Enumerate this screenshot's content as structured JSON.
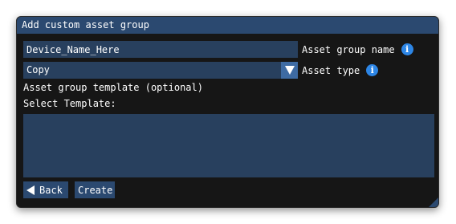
{
  "dialog": {
    "title": "Add custom asset group",
    "name_field": {
      "value": "Device_Name_Here",
      "label": "Asset group name",
      "info_icon": "i"
    },
    "type_field": {
      "selected": "Copy",
      "label": "Asset type",
      "info_icon": "i"
    },
    "template_heading": "Asset group template (optional)",
    "select_template_label": "Select Template:",
    "template_options": [],
    "buttons": {
      "back": "Back",
      "create": "Create"
    }
  },
  "colors": {
    "dialog_bg": "#161616",
    "title_bar": "#2b4970",
    "field_bg": "#28405e",
    "dropdown_arrow_bg": "#3e6ba3",
    "info_icon": "#2d86e6",
    "text": "#ffffff"
  },
  "icons": {
    "info": "info-icon",
    "dropdown": "chevron-down-icon",
    "back": "arrow-left-icon",
    "resize": "resize-grip-icon"
  }
}
